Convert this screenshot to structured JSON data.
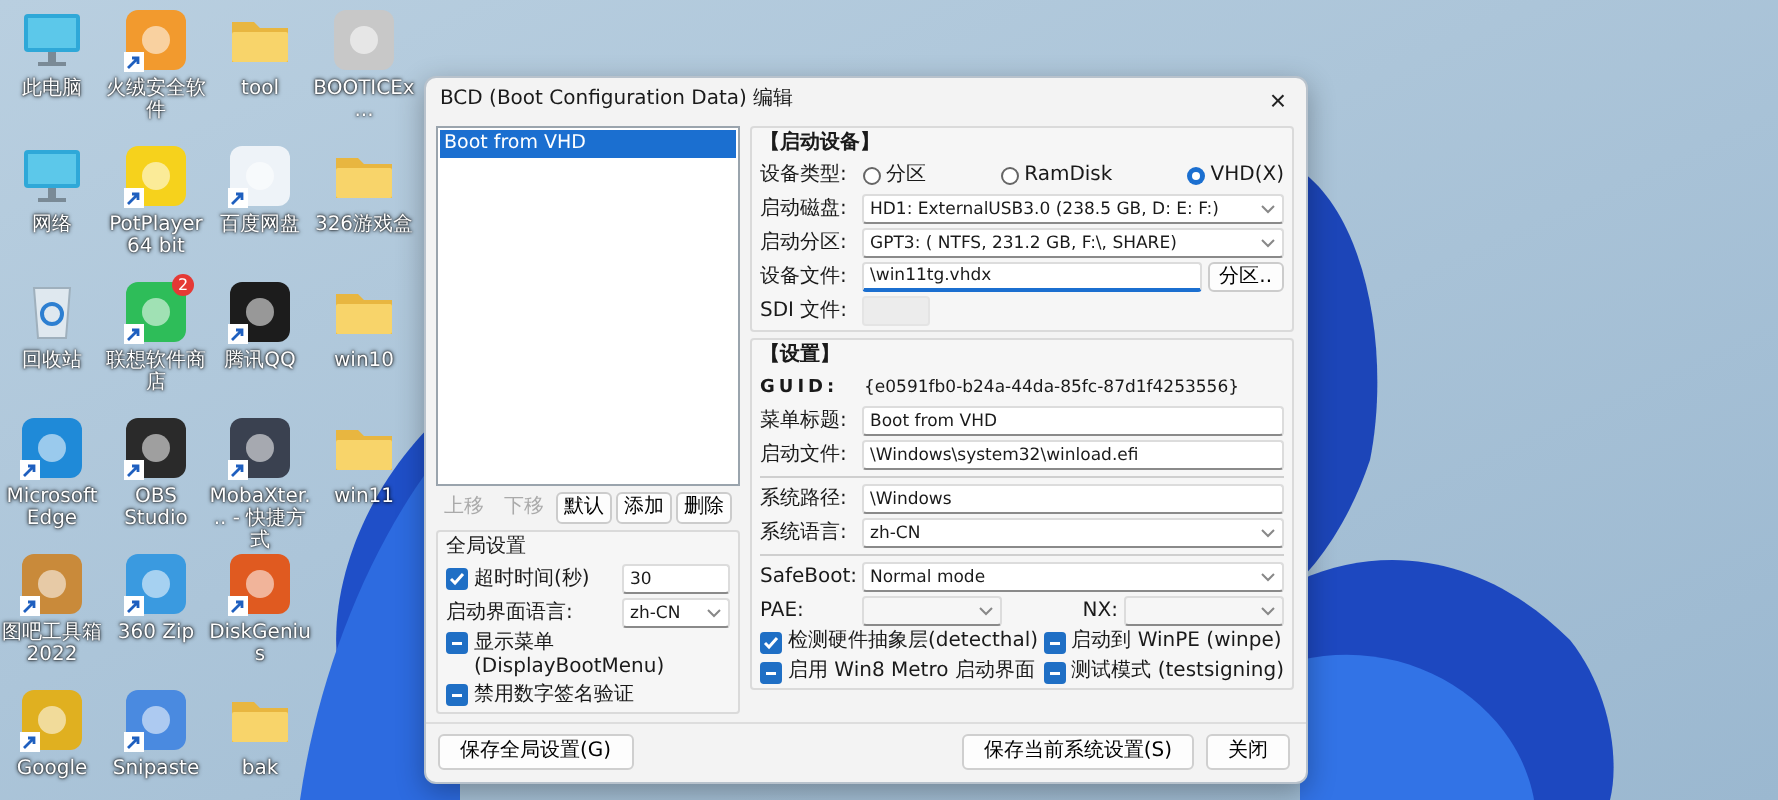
{
  "desktop_icons": [
    {
      "label": "此电脑",
      "kind": "computer",
      "shortcut": false
    },
    {
      "label": "网络",
      "kind": "computer",
      "shortcut": false
    },
    {
      "label": "回收站",
      "kind": "bin",
      "shortcut": false
    },
    {
      "label": "Microsoft Edge",
      "kind": "app",
      "color": "#1f8ad8",
      "shortcut": true
    },
    {
      "label": "图吧工具箱 2022",
      "kind": "app",
      "color": "#c98a3a",
      "shortcut": true
    },
    {
      "label": "Google",
      "kind": "app",
      "color": "#e0b020",
      "shortcut": true
    },
    {
      "label": "火绒安全软件",
      "kind": "app",
      "color": "#f29a2e",
      "shortcut": true
    },
    {
      "label": "PotPlayer 64 bit",
      "kind": "app",
      "color": "#f6d21c",
      "shortcut": true
    },
    {
      "label": "联想软件商店",
      "kind": "app",
      "color": "#2ebd59",
      "shortcut": true,
      "badge": "2"
    },
    {
      "label": "OBS Studio",
      "kind": "app",
      "color": "#2a2a2a",
      "shortcut": true
    },
    {
      "label": "360 Zip",
      "kind": "app",
      "color": "#3a9ae0",
      "shortcut": true
    },
    {
      "label": "Snipaste",
      "kind": "app",
      "color": "#4a8ae0",
      "shortcut": true
    },
    {
      "label": "tool",
      "kind": "folder",
      "shortcut": false
    },
    {
      "label": "百度网盘",
      "kind": "app",
      "color": "#eef3f8",
      "shortcut": true
    },
    {
      "label": "腾讯QQ",
      "kind": "app",
      "color": "#1c1c1c",
      "shortcut": true
    },
    {
      "label": "MobaXter... - 快捷方式",
      "kind": "app",
      "color": "#3a4150",
      "shortcut": true
    },
    {
      "label": "DiskGenius",
      "kind": "app",
      "color": "#e05a20",
      "shortcut": true
    },
    {
      "label": "bak",
      "kind": "folder",
      "shortcut": false
    },
    {
      "label": "BOOTICEx...",
      "kind": "app",
      "color": "#c8c8c8",
      "shortcut": false
    },
    {
      "label": "326游戏盒",
      "kind": "folder",
      "shortcut": false
    },
    {
      "label": "win10",
      "kind": "folder",
      "shortcut": false
    },
    {
      "label": "win11",
      "kind": "folder",
      "shortcut": false
    }
  ],
  "window": {
    "title": "BCD (Boot Configuration Data) 编辑",
    "close": "×"
  },
  "boot_list": {
    "items": [
      {
        "label": "Boot from VHD",
        "selected": true
      }
    ]
  },
  "list_buttons": [
    {
      "label": "上移",
      "disabled": true
    },
    {
      "label": "下移",
      "disabled": true
    },
    {
      "label": "默认",
      "disabled": false
    },
    {
      "label": "添加",
      "disabled": false
    },
    {
      "label": "删除",
      "disabled": false
    }
  ],
  "global_settings": {
    "title": "全局设置",
    "timeout": {
      "label": "超时时间(秒)",
      "checked": true,
      "mixed": false,
      "value": "30"
    },
    "ui_language": {
      "label": "启动界面语言:",
      "value": "zh-CN"
    },
    "checks": [
      {
        "label": "显示菜单 (DisplayBootMenu)",
        "checked": true,
        "mixed": true
      },
      {
        "label": "禁用数字签名验证",
        "checked": true,
        "mixed": true
      }
    ]
  },
  "boot_device": {
    "title": "【启动设备】",
    "device_type_label": "设备类型:",
    "radios": [
      {
        "label": "分区",
        "selected": false
      },
      {
        "label": "RamDisk",
        "selected": false
      },
      {
        "label": "VHD(X)",
        "selected": true
      }
    ],
    "rows": [
      {
        "kind": "select",
        "label": "启动磁盘:",
        "value": "HD1: ExternalUSB3.0 (238.5 GB, D: E: F:)"
      },
      {
        "kind": "select",
        "label": "启动分区:",
        "value": "GPT3: ( NTFS, 231.2 GB, F:\\, SHARE)"
      },
      {
        "kind": "file",
        "label": "设备文件:",
        "value": "\\win11tg.vhdx",
        "button": "分区.."
      },
      {
        "kind": "disabled",
        "label": "SDI 文件:"
      }
    ]
  },
  "settings": {
    "title": "【设置】",
    "rows": [
      {
        "kind": "readonly",
        "label": "GUID:",
        "value": "{e0591fb0-b24a-44da-85fc-87d1f4253556}"
      },
      {
        "kind": "text",
        "label": "菜单标题:",
        "value": "Boot from VHD"
      },
      {
        "kind": "text",
        "label": "启动文件:",
        "value": "\\Windows\\system32\\winload.efi"
      },
      {
        "kind": "separator"
      },
      {
        "kind": "text",
        "label": "系统路径:",
        "value": "\\Windows"
      },
      {
        "kind": "select",
        "label": "系统语言:",
        "value": "zh-CN"
      },
      {
        "kind": "separator"
      },
      {
        "kind": "select",
        "label": "SafeBoot:",
        "value": "Normal mode"
      }
    ],
    "pae_label": "PAE:",
    "nx_label": "NX:",
    "checks": [
      {
        "label": "检测硬件抽象层(detecthal)",
        "checked": true,
        "mixed": false
      },
      {
        "label": "启动到 WinPE (winpe)",
        "checked": true,
        "mixed": true
      },
      {
        "label": "启用 Win8 Metro 启动界面",
        "checked": true,
        "mixed": true
      },
      {
        "label": "测试模式 (testsigning)",
        "checked": true,
        "mixed": true
      }
    ]
  },
  "footer_buttons": [
    {
      "label": "保存全局设置(G)"
    },
    {
      "label": "保存当前系统设置(S)"
    },
    {
      "label": "关闭"
    }
  ]
}
